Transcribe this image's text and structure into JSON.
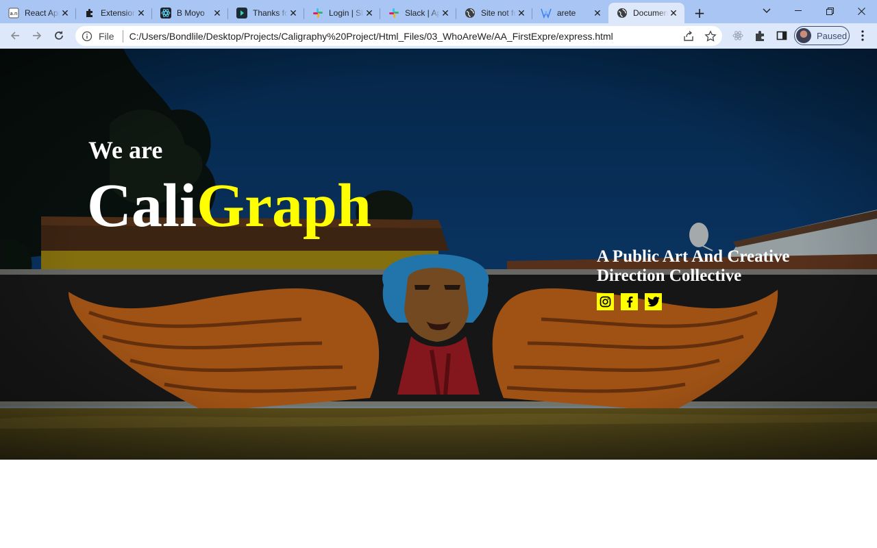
{
  "browser": {
    "tabs": [
      {
        "title": "React App",
        "icon": "react-app-icon",
        "active": false
      },
      {
        "title": "Extensions",
        "icon": "puzzle-icon",
        "active": false
      },
      {
        "title": "B Moyo",
        "icon": "react-icon",
        "active": false
      },
      {
        "title": "Thanks for",
        "icon": "play-icon",
        "active": false
      },
      {
        "title": "Login | Slack",
        "icon": "slack-icon",
        "active": false
      },
      {
        "title": "Slack | App",
        "icon": "slack-icon",
        "active": false
      },
      {
        "title": "Site not found",
        "icon": "globe-icon",
        "active": false
      },
      {
        "title": "arete",
        "icon": "v-logo-icon",
        "active": false
      },
      {
        "title": "Document",
        "icon": "globe-icon",
        "active": true
      }
    ],
    "new_tab_label": "+",
    "address": {
      "scheme": "File",
      "url": "C:/Users/Bondlile/Desktop/Projects/Caligraphy%20Project/Html_Files/03_WhoAreWe/AA_FirstExpre/express.html"
    },
    "profile_status": "Paused"
  },
  "hero": {
    "intro": "We are",
    "brand_part1": "Cali",
    "brand_part2": "Graph",
    "tagline": "A Public Art And Creative Direction Collective",
    "socials": [
      {
        "name": "instagram-icon"
      },
      {
        "name": "facebook-icon"
      },
      {
        "name": "twitter-icon"
      }
    ],
    "accent_color": "#ffff00"
  }
}
